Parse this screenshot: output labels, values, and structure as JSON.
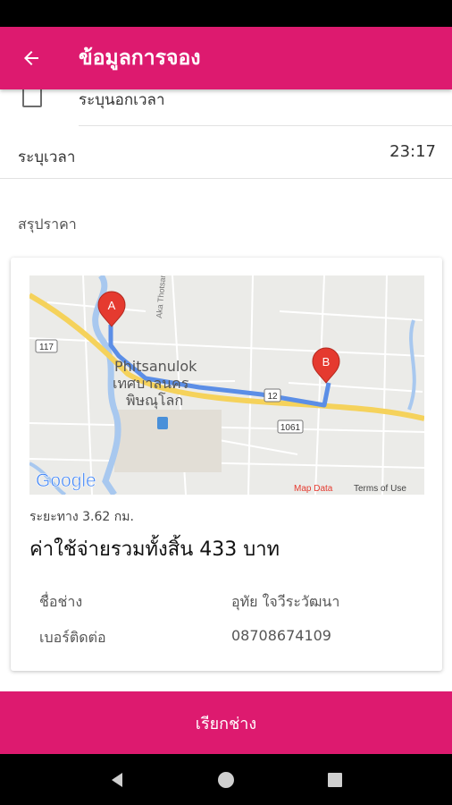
{
  "app_bar": {
    "title": "ข้อมูลการจอง"
  },
  "form": {
    "checkbox_label": "ระบุนอกเวลา",
    "time_label": "ระบุเวลา",
    "time_value": "23:17",
    "summary_label": "สรุปราคา"
  },
  "map": {
    "city_en": "Phitsanulok",
    "city_th_line1": "เทศบาลนคร",
    "city_th_line2": "พิษณุโลก",
    "marker_a": "A",
    "marker_b": "B",
    "road_117": "117",
    "road_12": "12",
    "road_1061": "1061",
    "google_logo": "Google",
    "map_data": "Map Data",
    "terms": "Terms of Use",
    "street_label": "Aka Thotsarot"
  },
  "summary": {
    "distance": "ระยะทาง 3.62 กม.",
    "total_cost": "ค่าใช้จ่ายรวมทั้งสิ้น 433 บาท",
    "technician_label": "ชื่อช่าง",
    "technician_name": "อุทัย ใจวีระวัฒนา",
    "phone_label": "เบอร์ติดต่อ",
    "phone_value": "08708674109"
  },
  "bottom_button": {
    "label": "เรียกช่าง"
  },
  "colors": {
    "primary": "#dd1a6f",
    "route": "#5b8ee6",
    "marker": "#e53a2f"
  }
}
